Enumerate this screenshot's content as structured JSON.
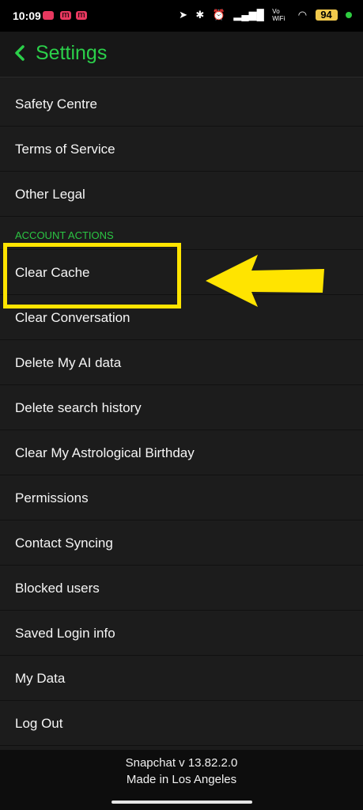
{
  "status_bar": {
    "time": "10:09",
    "notif_icons": [
      "youtube-icon",
      "m-app-icon",
      "m-app-icon"
    ],
    "battery_label": "94",
    "network_label": "Vo WiFi"
  },
  "header": {
    "title": "Settings"
  },
  "items_top": [
    {
      "label": "Safety Centre"
    },
    {
      "label": "Terms of Service"
    },
    {
      "label": "Other Legal"
    }
  ],
  "section": {
    "label": "ACCOUNT ACTIONS"
  },
  "items_account": [
    {
      "label": "Clear Cache"
    },
    {
      "label": "Clear Conversation"
    },
    {
      "label": "Delete My AI data"
    },
    {
      "label": "Delete search history"
    },
    {
      "label": "Clear My Astrological Birthday"
    },
    {
      "label": "Permissions"
    },
    {
      "label": "Contact Syncing"
    },
    {
      "label": "Blocked users"
    },
    {
      "label": "Saved Login info"
    },
    {
      "label": "My Data"
    },
    {
      "label": "Log Out"
    }
  ],
  "footer": {
    "version": "Snapchat v 13.82.2.0",
    "made_in": "Made in Los Angeles"
  },
  "colors": {
    "accent_green": "#2bd04a",
    "annotation_yellow": "#ffe400",
    "background": "#1c1c1c"
  }
}
